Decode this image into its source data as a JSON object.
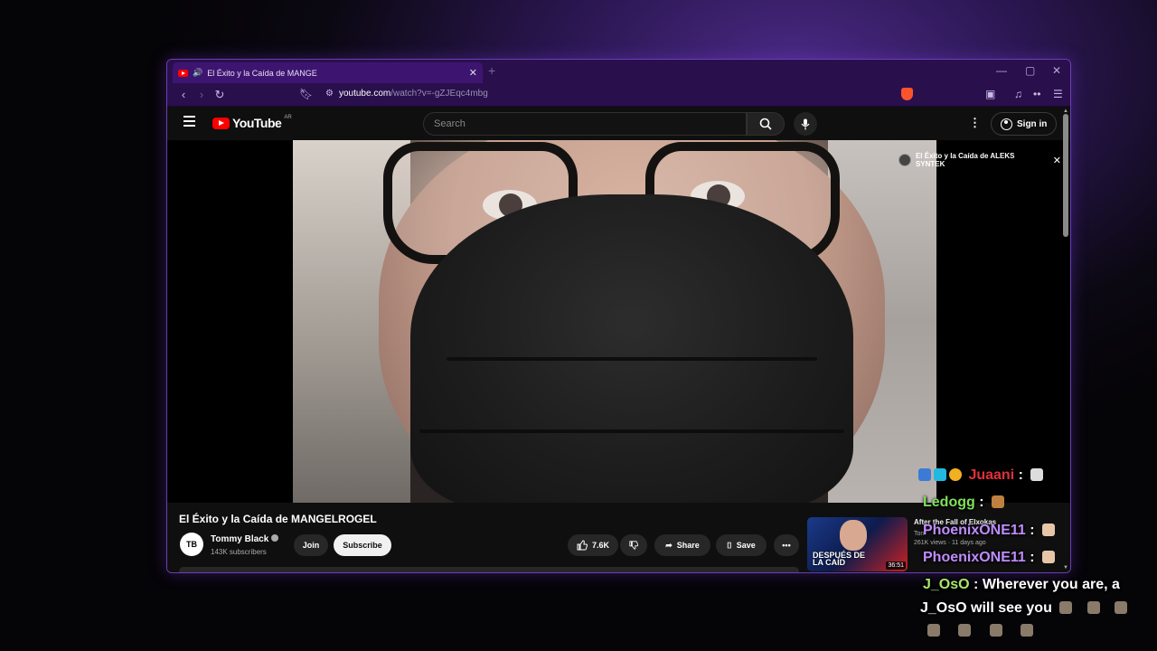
{
  "browser": {
    "tab_title": "El Éxito y la Caída de MANGE",
    "tab_audio_icon": "speaker-icon",
    "url_host": "youtube.com",
    "url_path": "/watch?v=-gZJEqc4mbg",
    "accent": "#6b3fb4"
  },
  "youtube": {
    "logo_text": "YouTube",
    "country_code": "AR",
    "search_placeholder": "Search",
    "signin_label": "Sign in",
    "overlay_title": "El Éxito y la Caída de ALEKS SYNTEK"
  },
  "video": {
    "title": "El Éxito y la Caída de MANGELROGEL",
    "channel": "Tommy Black",
    "subscribers": "143K subscribers",
    "join_label": "Join",
    "subscribe_label": "Subscribe",
    "likes": "7.6K",
    "share_label": "Share",
    "save_label": "Save"
  },
  "recommended": {
    "title": "After the Fall of Elxokas",
    "channel": "Tom",
    "meta": "261K views · 11 days ago",
    "duration": "36:51",
    "thumb_text_1": "DESPUÉS DE",
    "thumb_text_2": "LA CAÍD"
  },
  "chat": [
    {
      "user": "Juaani",
      "color": "#e0303a",
      "sep": " :",
      "message": ""
    },
    {
      "user": "Ledogg",
      "color": "#7fe05a",
      "sep": " :",
      "message": ""
    },
    {
      "user": "PhoenixONE11",
      "color": "#c08cff",
      "sep": " :",
      "message": ""
    },
    {
      "user": "PhoenixONE11",
      "color": "#c08cff",
      "sep": " :",
      "message": ""
    },
    {
      "user": "J_OsO",
      "color": "#a8e86a",
      "sep": " : ",
      "message": "Wherever you are, a"
    },
    {
      "user": "",
      "color": "#ffffff",
      "sep": "",
      "message": "J_OsO will see you"
    }
  ]
}
